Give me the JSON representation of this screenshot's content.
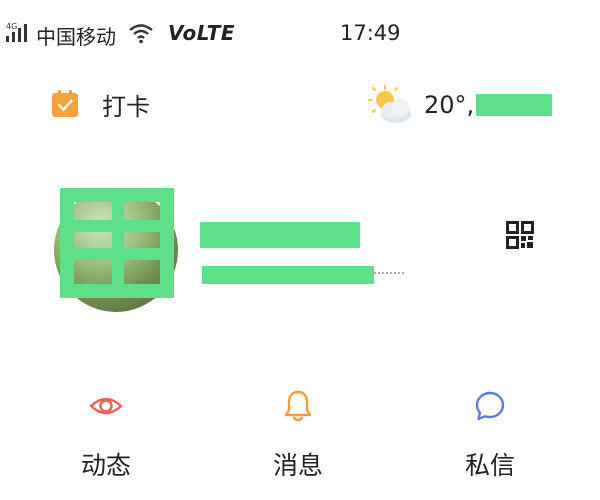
{
  "status_bar": {
    "network_tag": "4G",
    "carrier": "中国移动",
    "volte": "VoLTE",
    "time": "17:49"
  },
  "checkin": {
    "icon": "calendar-check-icon",
    "label": "打卡"
  },
  "weather": {
    "icon": "partly-cloudy-icon",
    "temperature": "20°,"
  },
  "profile": {
    "avatar": "avatar-photo",
    "qr_icon": "qr-code-icon"
  },
  "nav": {
    "tabs": [
      {
        "label": "动态",
        "icon": "eye-icon",
        "color": "#e8645a"
      },
      {
        "label": "消息",
        "icon": "bell-icon",
        "color": "#f39c3a"
      },
      {
        "label": "私信",
        "icon": "chat-bubble-icon",
        "color": "#5b7be0"
      }
    ]
  },
  "colors": {
    "accent_orange": "#f5a23a",
    "redaction": "#5de089"
  }
}
